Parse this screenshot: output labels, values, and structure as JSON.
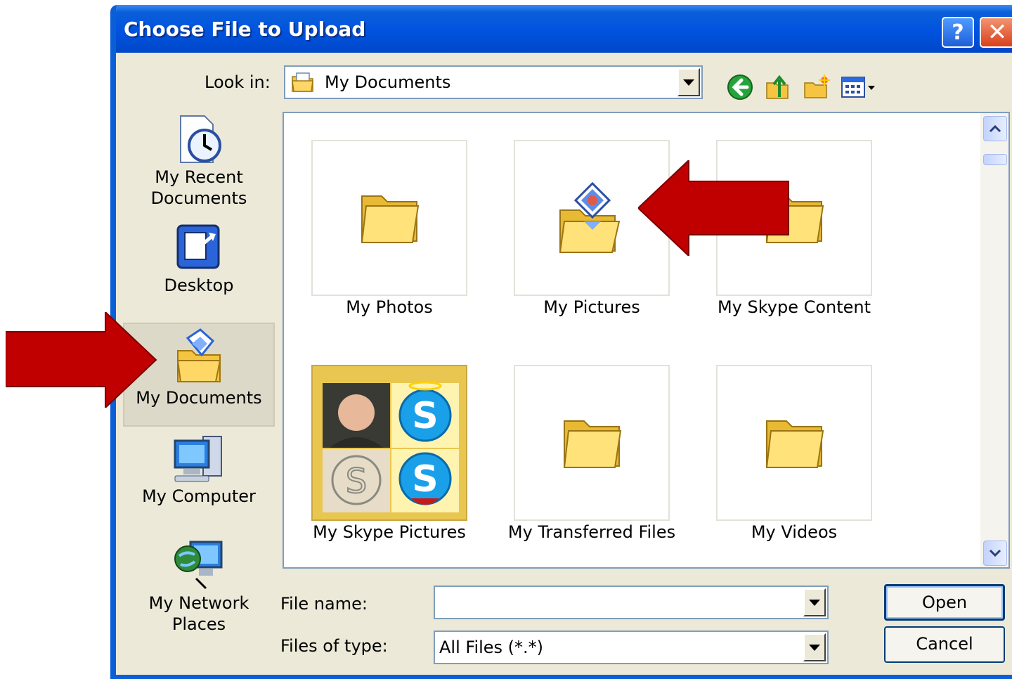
{
  "dialog": {
    "title": "Choose File to Upload",
    "help_label": "?",
    "close_label": "✕"
  },
  "toolbar": {
    "look_in_label": "Look in:",
    "look_in_value": "My Documents",
    "icons": [
      "back-icon",
      "up-folder-icon",
      "new-folder-icon",
      "views-menu-icon"
    ]
  },
  "places": {
    "items": [
      {
        "label_lines": [
          "My Recent",
          "Documents"
        ],
        "icon": "recent-documents-icon"
      },
      {
        "label_lines": [
          "Desktop"
        ],
        "icon": "desktop-icon"
      },
      {
        "label_lines": [
          "My Documents"
        ],
        "icon": "my-documents-icon",
        "selected": true
      },
      {
        "label_lines": [
          "My Computer"
        ],
        "icon": "my-computer-icon"
      },
      {
        "label_lines": [
          "My Network",
          "Places"
        ],
        "icon": "network-places-icon"
      }
    ]
  },
  "files": {
    "items": [
      {
        "label": "My Photos",
        "icon": "folder-icon"
      },
      {
        "label": "My Pictures",
        "icon": "pictures-folder-icon"
      },
      {
        "label": "My Skype Content",
        "icon": "folder-icon"
      },
      {
        "label": "My Skype Pictures",
        "icon": "skype-pictures-thumbnail"
      },
      {
        "label": "My Transferred Files",
        "icon": "folder-icon"
      },
      {
        "label": "My Videos",
        "icon": "folder-icon"
      }
    ]
  },
  "form": {
    "file_name_label": "File name:",
    "file_name_value": "",
    "files_of_type_label": "Files of type:",
    "files_of_type_value": "All Files (*.*)"
  },
  "buttons": {
    "open_label": "Open",
    "cancel_label": "Cancel"
  },
  "colors": {
    "titlebar": "#0053e0",
    "dialog_bg": "#ece9d8",
    "annotation_arrow": "#c00000"
  }
}
